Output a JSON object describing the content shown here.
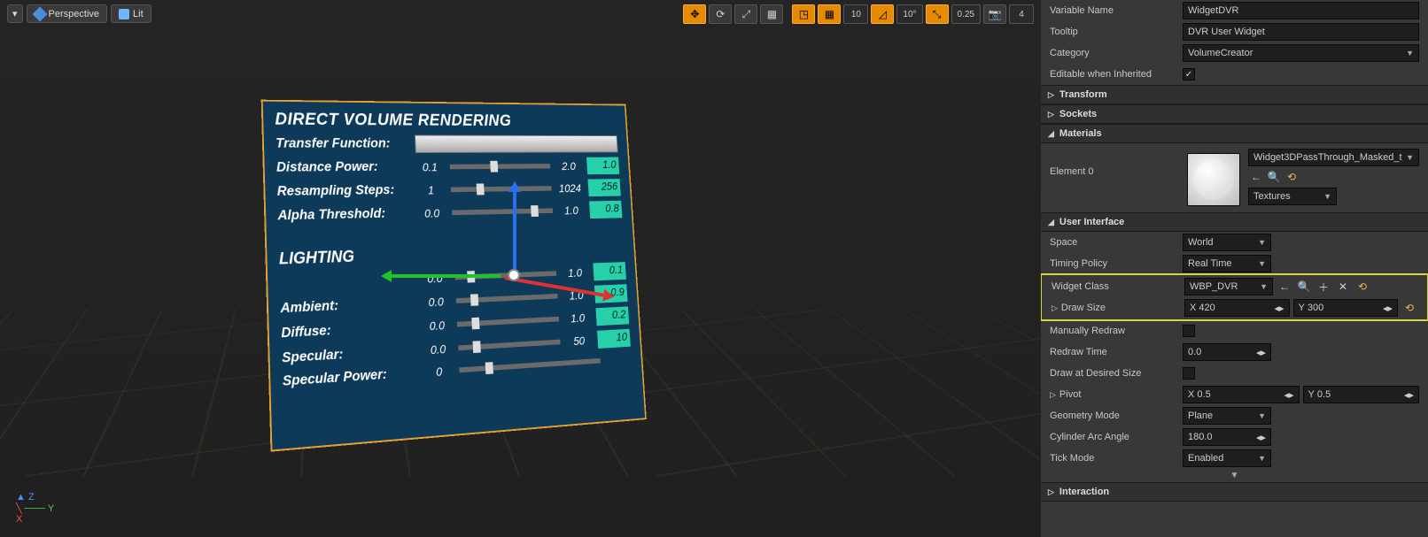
{
  "toolbar": {
    "perspective": "Perspective",
    "lit": "Lit",
    "snap_grid": "10",
    "snap_angle": "10°",
    "snap_scale": "0.25",
    "cam_speed": "4"
  },
  "widget3d": {
    "title": "DIRECT VOLUME RENDERING",
    "transfer_label": "Transfer Function:",
    "rows": [
      {
        "label": "Distance Power:",
        "min": "0.1",
        "max": "2.0",
        "val": "1.0",
        "p": "40%"
      },
      {
        "label": "Resampling Steps:",
        "min": "1",
        "max": "1024",
        "val": "256",
        "p": "25%"
      },
      {
        "label": "Alpha Threshold:",
        "min": "0.0",
        "max": "1.0",
        "val": "0.8",
        "p": "78%"
      }
    ],
    "lighting_label": "LIGHTING",
    "light_rows": [
      {
        "label": "",
        "min": "0.0",
        "max": "1.0",
        "val": "0.1",
        "p": "12%"
      },
      {
        "label": "Ambient:",
        "min": "0.0",
        "max": "1.0",
        "val": "0.9",
        "p": "14%"
      },
      {
        "label": "Diffuse:",
        "min": "0.0",
        "max": "1.0",
        "val": "0.2",
        "p": "14%"
      },
      {
        "label": "Specular:",
        "min": "0.0",
        "max": "50",
        "val": "10",
        "p": "14%"
      },
      {
        "label": "Specular Power:",
        "min": "0",
        "max": "",
        "val": "",
        "p": "18%"
      }
    ]
  },
  "details": {
    "var_name_label": "Variable Name",
    "var_name": "WidgetDVR",
    "tooltip_label": "Tooltip",
    "tooltip": "DVR User Widget",
    "category_label": "Category",
    "category": "VolumeCreator",
    "edit_inherit_label": "Editable when Inherited",
    "sections": {
      "transform": "Transform",
      "sockets": "Sockets",
      "materials": "Materials",
      "ui": "User Interface"
    },
    "mat_element": "Element 0",
    "mat_name": "Widget3DPassThrough_Masked_t",
    "textures": "Textures",
    "space_label": "Space",
    "space": "World",
    "timing_label": "Timing Policy",
    "timing": "Real Time",
    "widget_class_label": "Widget Class",
    "widget_class": "WBP_DVR",
    "draw_size_label": "Draw Size",
    "draw_x": "420",
    "draw_y": "300",
    "manual_label": "Manually Redraw",
    "redraw_time_label": "Redraw Time",
    "redraw_time": "0.0",
    "desired_label": "Draw at Desired Size",
    "pivot_label": "Pivot",
    "pivot_x": "0.5",
    "pivot_y": "0.5",
    "geom_label": "Geometry Mode",
    "geom": "Plane",
    "cyl_label": "Cylinder Arc Angle",
    "cyl": "180.0",
    "tick_label": "Tick Mode",
    "tick": "Enabled",
    "interaction": "Interaction"
  },
  "axis": {
    "x": "X",
    "y": "Y",
    "z": "Z"
  }
}
